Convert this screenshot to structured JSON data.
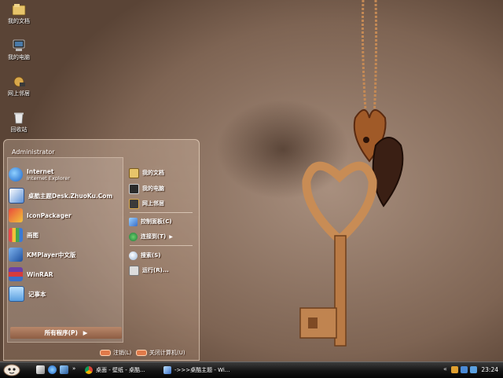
{
  "desktop": {
    "icons": [
      {
        "label": "我的文档",
        "icon": "my-documents-icon"
      },
      {
        "label": "我的电脑",
        "icon": "my-computer-icon"
      },
      {
        "label": "网上邻居",
        "icon": "network-icon"
      },
      {
        "label": "回收站",
        "icon": "recycle-bin-icon"
      }
    ]
  },
  "start_menu": {
    "user": "Administrator",
    "pinned": [
      {
        "title": "Internet",
        "subtitle": "Internet Explorer",
        "icon": "internet-explorer-icon"
      },
      {
        "title": "桌酷主题Desk.ZhuoKu.Com",
        "icon": "zhuoku-theme-icon"
      },
      {
        "title": "IconPackager",
        "icon": "iconpackager-icon"
      },
      {
        "title": "画图",
        "icon": "paint-icon"
      },
      {
        "title": "KMPlayer中文版",
        "icon": "kmplayer-icon"
      },
      {
        "title": "WinRAR",
        "icon": "winrar-icon"
      },
      {
        "title": "记事本",
        "icon": "notepad-icon"
      }
    ],
    "all_programs": "所有程序(P)",
    "places": [
      {
        "label": "我的文档",
        "icon": "my-documents-icon"
      },
      {
        "label": "我的电脑",
        "icon": "my-computer-icon"
      },
      {
        "label": "网上邻居",
        "icon": "network-icon"
      },
      {
        "label": "控制面板(C)",
        "icon": "control-panel-icon"
      },
      {
        "label": "连接到(T)",
        "icon": "connect-to-icon"
      },
      {
        "label": "搜索(S)",
        "icon": "search-icon"
      },
      {
        "label": "运行(R)...",
        "icon": "run-icon"
      }
    ],
    "logoff": "注销(L)",
    "shutdown": "关闭计算机(U)"
  },
  "taskbar": {
    "tasks": [
      {
        "label": "桌面 - 壁纸 - 桌酷...",
        "icon": "chrome-icon"
      },
      {
        "label": "->>>桌酷主题 - Wi...",
        "icon": "window-icon"
      }
    ],
    "clock": "23:24"
  },
  "colors": {
    "menu_accent": "#8e5e44",
    "taskbar": "#141414",
    "pill": "#e07a4a"
  }
}
